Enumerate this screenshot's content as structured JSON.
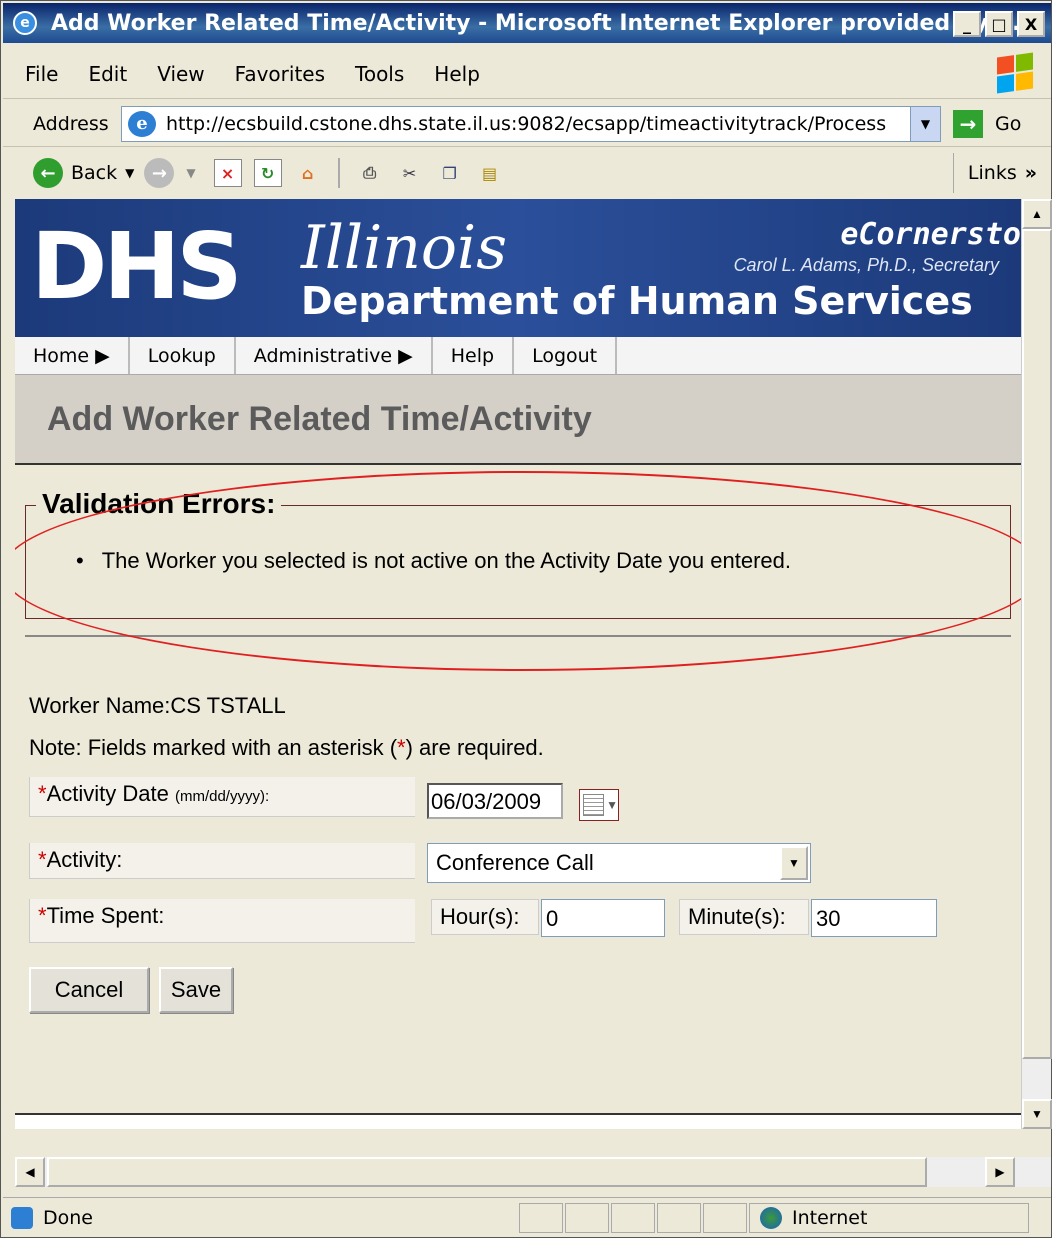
{
  "window": {
    "title": "Add Worker Related Time/Activity - Microsoft Internet Explorer provided by I...",
    "controls": [
      "_",
      "□",
      "X"
    ]
  },
  "menu": {
    "items": [
      {
        "label": "File",
        "accel": "F"
      },
      {
        "label": "Edit",
        "accel": "E"
      },
      {
        "label": "View",
        "accel": "V"
      },
      {
        "label": "Favorites",
        "accel": "a"
      },
      {
        "label": "Tools",
        "accel": "T"
      },
      {
        "label": "Help",
        "accel": "H"
      }
    ]
  },
  "address": {
    "label": "Address",
    "url": "http://ecsbuild.cstone.dhs.state.il.us:9082/ecsapp/timeactivitytrack/Process",
    "go_label": "Go"
  },
  "toolbar": {
    "back_label": "Back",
    "links_label": "Links",
    "icons": [
      "back-icon",
      "forward-icon",
      "stop-icon",
      "refresh-icon",
      "home-icon",
      "print-icon",
      "cut-icon",
      "copy-icon",
      "paste-icon"
    ]
  },
  "banner": {
    "logo_text": "DHS",
    "state": "Illinois",
    "department": "Department of Human Services",
    "app_name": "eCornersto",
    "secretary": "Carol L. Adams, Ph.D., Secretary",
    "bg_color": "#1c3a7a"
  },
  "app_nav": [
    {
      "label": "Home ▶"
    },
    {
      "label": "Lookup"
    },
    {
      "label": "Administrative ▶"
    },
    {
      "label": "Help"
    },
    {
      "label": "Logout"
    }
  ],
  "page": {
    "title": "Add Worker Related Time/Activity",
    "validation_title": "Validation Errors:",
    "errors": [
      "The Worker you selected is not active on the Activity Date you entered."
    ],
    "worker_name_label": "Worker Name:",
    "worker_name": "CS TSTALL",
    "note_prefix": "Note: Fields marked with an asterisk (",
    "note_asterisk": "*",
    "note_suffix": ") are required.",
    "accent_color": "#cc0000"
  },
  "form": {
    "activity_date_label": "Activity Date",
    "activity_date_format": "(mm/dd/yyyy):",
    "activity_date_value": "06/03/2009",
    "activity_label": "Activity:",
    "activity_value": "Conference Call",
    "time_spent_label": "Time Spent:",
    "hours_label": "Hour(s):",
    "hours_value": "0",
    "minutes_label": "Minute(s):",
    "minutes_value": "30",
    "required_mark": "*"
  },
  "buttons": {
    "cancel": "Cancel",
    "save": "Save"
  },
  "status": {
    "text": "Done",
    "zone": "Internet"
  }
}
